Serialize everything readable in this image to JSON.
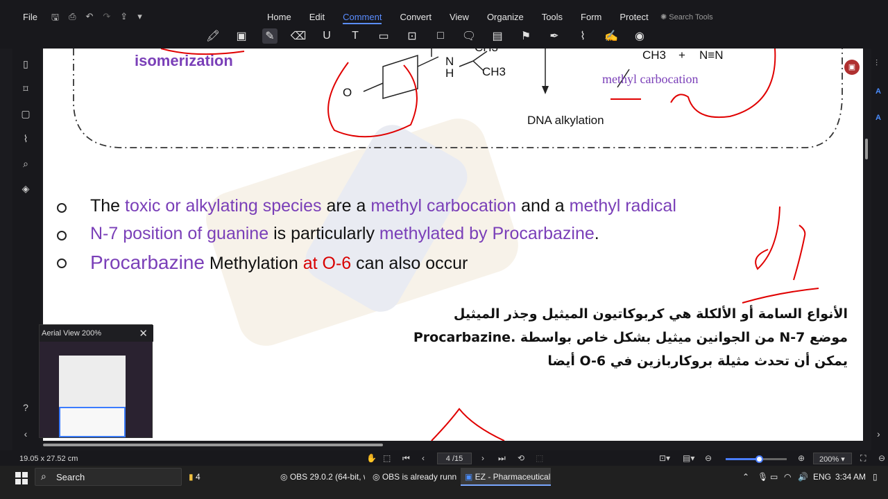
{
  "menu": {
    "file": "File",
    "tabs": [
      "Home",
      "Edit",
      "Comment",
      "Convert",
      "View",
      "Organize",
      "Tools",
      "Form",
      "Protect"
    ],
    "active_tab": "Comment",
    "search_tools": "Search Tools"
  },
  "toolbar": {
    "tools": [
      "highlight-icon",
      "area-highlight-icon",
      "pencil-icon",
      "eraser-icon",
      "underline-icon",
      "text-icon",
      "textbox-icon",
      "callout-icon",
      "shape-icon",
      "note-icon",
      "measure-icon",
      "stamp-icon",
      "sign-icon",
      "attach-icon",
      "form-icon",
      "eye-icon"
    ],
    "selected_tool": "pencil-icon"
  },
  "figure": {
    "isomerization": "isomerization",
    "nh": "N\nH",
    "ch3_top": "CH3",
    "ch3": "CH3",
    "dna_alkylation": "DNA alkylation",
    "methyl_ion": "CH3",
    "plus": "+",
    "diazo": "N≡N",
    "methyl_carbocation": "methyl carbocation"
  },
  "bullets": [
    {
      "segments": [
        {
          "text": "The ",
          "style": "plain"
        },
        {
          "text": "toxic or alkylating species",
          "style": "purple"
        },
        {
          "text": " are a ",
          "style": "plain"
        },
        {
          "text": "methyl carbocation",
          "style": "purple"
        },
        {
          "text": " and a ",
          "style": "plain"
        },
        {
          "text": "methyl radical",
          "style": "purple"
        }
      ]
    },
    {
      "segments": [
        {
          "text": "N-7 position of guanine",
          "style": "purple"
        },
        {
          "text": " is particularly ",
          "style": "plain"
        },
        {
          "text": "methylated by Procarbazine",
          "style": "purple"
        },
        {
          "text": ".",
          "style": "plain"
        }
      ]
    },
    {
      "segments": [
        {
          "text": "Procarbazine",
          "style": "purple"
        },
        {
          "text": " Methylation ",
          "style": "plain"
        },
        {
          "text": "at O-6",
          "style": "red"
        },
        {
          "text": " can also occur",
          "style": "plain"
        }
      ]
    }
  ],
  "arabic_lines": [
    "الأنواع السامة أو الألكلة هي كربوكاتيون الميثيل وجذر الميثيل",
    "موضع N-7 من الجوانين ميثيل بشكل خاص بواسطة .Procarbazine",
    "يمكن أن تحدث مثيلة بروكاربازين في O-6 أيضا"
  ],
  "aerial_view": {
    "title": "Aerial View  200%"
  },
  "statusbar": {
    "dimensions": "19.05 x 27.52 cm",
    "page_indicator": "4 /15",
    "zoom": "200%",
    "zoom_level": 0.55
  },
  "taskbar": {
    "search": "Search",
    "items": [
      {
        "label": "4",
        "active": false
      },
      {
        "label": "OBS 29.0.2 (64-bit, wi...",
        "active": false
      },
      {
        "label": "OBS is already running",
        "active": false
      },
      {
        "label": "EZ - Pharmaceutical c...",
        "active": true
      }
    ],
    "lang": "ENG",
    "time": "3:34 AM"
  },
  "colors": {
    "accent": "#5a8dff",
    "purple_text": "#7a3fb8",
    "red_text": "#d90000",
    "ink": "#e00000"
  }
}
